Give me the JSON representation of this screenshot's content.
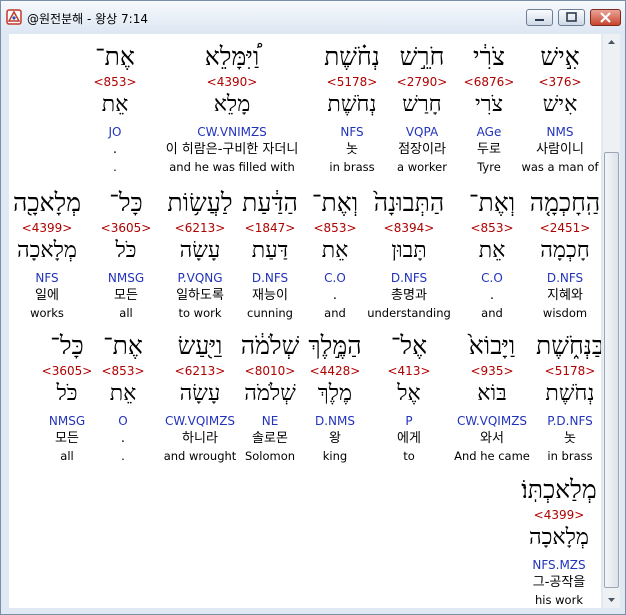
{
  "window": {
    "title": "@원전분해 - 왕상 7:14",
    "buttons": [
      "minimize",
      "maximize",
      "close"
    ],
    "accent": "#b00000",
    "parsing_color": "#2233bb"
  },
  "rows": [
    {
      "words": [
        {
          "hebrew": "אִ֣ישׁ",
          "strong": "<376>",
          "lemma": "אִישׁ",
          "parsing": "NMS",
          "korean": "사람이니",
          "english": "was a man of"
        },
        {
          "hebrew": "צֹרִ֔י",
          "strong": "<6876>",
          "lemma": "צֹרִי",
          "parsing": "AGe",
          "korean": "두로",
          "english": "Tyre"
        },
        {
          "hebrew": "חֹרֵ֣שׁ",
          "strong": "<2790>",
          "lemma": "חָרַשׁ",
          "parsing": "VQPA",
          "korean": "점장이라",
          "english": "a worker"
        },
        {
          "hebrew": "נְחֹ֗שֶׁת",
          "strong": "<5178>",
          "lemma": "נְחֹשֶׁת",
          "parsing": "NFS",
          "korean": "놋",
          "english": "in brass"
        },
        {
          "hebrew": "וַ֠יִּמָּלֵא",
          "strong": "<4390>",
          "lemma": "מָלֵא",
          "parsing": "CW.VNIMZS",
          "korean": "이 히람은-구비한 자더니",
          "english": "and he was filled with"
        },
        {
          "hebrew": "אֶת־",
          "strong": "<853>",
          "lemma": "אֵת",
          "parsing": "JO",
          "korean": ".",
          "english": "."
        }
      ]
    },
    {
      "words": [
        {
          "hebrew": "הַֽחָכְמָ֤ה",
          "strong": "<2451>",
          "lemma": "חָכְמָה",
          "parsing": "D.NFS",
          "korean": "지혜와",
          "english": "wisdom"
        },
        {
          "hebrew": "וְאֶת־",
          "strong": "<853>",
          "lemma": "אֵת",
          "parsing": "C.O",
          "korean": ".",
          "english": "and"
        },
        {
          "hebrew": "הַתְּבוּנָה֙",
          "strong": "<8394>",
          "lemma": "תָּבוּן",
          "parsing": "D.NFS",
          "korean": "총명과",
          "english": "understanding"
        },
        {
          "hebrew": "וְאֶת־",
          "strong": "<853>",
          "lemma": "אֵת",
          "parsing": "C.O",
          "korean": ".",
          "english": "and"
        },
        {
          "hebrew": "הַדַּ֔עַת",
          "strong": "<1847>",
          "lemma": "דַּעַת",
          "parsing": "D.NFS",
          "korean": "재능이",
          "english": "cunning"
        },
        {
          "hebrew": "לַעֲשׂ֥וֹת",
          "strong": "<6213>",
          "lemma": "עָשָׂה",
          "parsing": "P.VQNG",
          "korean": "일하도록",
          "english": "to work"
        },
        {
          "hebrew": "כָּל־",
          "strong": "<3605>",
          "lemma": "כֹּל",
          "parsing": "NMSG",
          "korean": "모든",
          "english": "all"
        },
        {
          "hebrew": "מְלָאכָ֖ה",
          "strong": "<4399>",
          "lemma": "מְלָאכָה",
          "parsing": "NFS",
          "korean": "일에",
          "english": "works"
        }
      ]
    },
    {
      "words": [
        {
          "hebrew": "בַּנְּחֹ֑שֶׁת",
          "strong": "<5178>",
          "lemma": "נְחֹשֶׁת",
          "parsing": "P.D.NFS",
          "korean": "놋",
          "english": "in brass"
        },
        {
          "hebrew": "וַיָּבוֹא֙",
          "strong": "<935>",
          "lemma": "בּוֹא",
          "parsing": "CW.VQIMZS",
          "korean": "와서",
          "english": "And he came"
        },
        {
          "hebrew": "אֶל־",
          "strong": "<413>",
          "lemma": "אֶל",
          "parsing": "P",
          "korean": "에게",
          "english": "to"
        },
        {
          "hebrew": "הַמֶּ֣לֶךְ",
          "strong": "<4428>",
          "lemma": "מֶלֶךְ",
          "parsing": "D.NMS",
          "korean": "왕",
          "english": "king"
        },
        {
          "hebrew": "שְׁלֹמֹ֔ה",
          "strong": "<8010>",
          "lemma": "שְׁלֹמֹה",
          "parsing": "NE",
          "korean": "솔로몬",
          "english": "Solomon"
        },
        {
          "hebrew": "וַיַּ֖עַשׂ",
          "strong": "<6213>",
          "lemma": "עָשָׂה",
          "parsing": "CW.VQIMZS",
          "korean": "하니라",
          "english": "and wrought"
        },
        {
          "hebrew": "אֶת־",
          "strong": "<853>",
          "lemma": "אֵת",
          "parsing": "O",
          "korean": ".",
          "english": "."
        },
        {
          "hebrew": "כָּל־",
          "strong": "<3605>",
          "lemma": "כֹּל",
          "parsing": "NMSG",
          "korean": "모든",
          "english": "all"
        }
      ]
    },
    {
      "words": [
        {
          "hebrew": "מְלַאכְתּֽוֹ׃",
          "strong": "<4399>",
          "lemma": "מְלָאכָה",
          "parsing": "NFS.MZS",
          "korean": "그-공작을",
          "english": "his work"
        }
      ]
    }
  ]
}
